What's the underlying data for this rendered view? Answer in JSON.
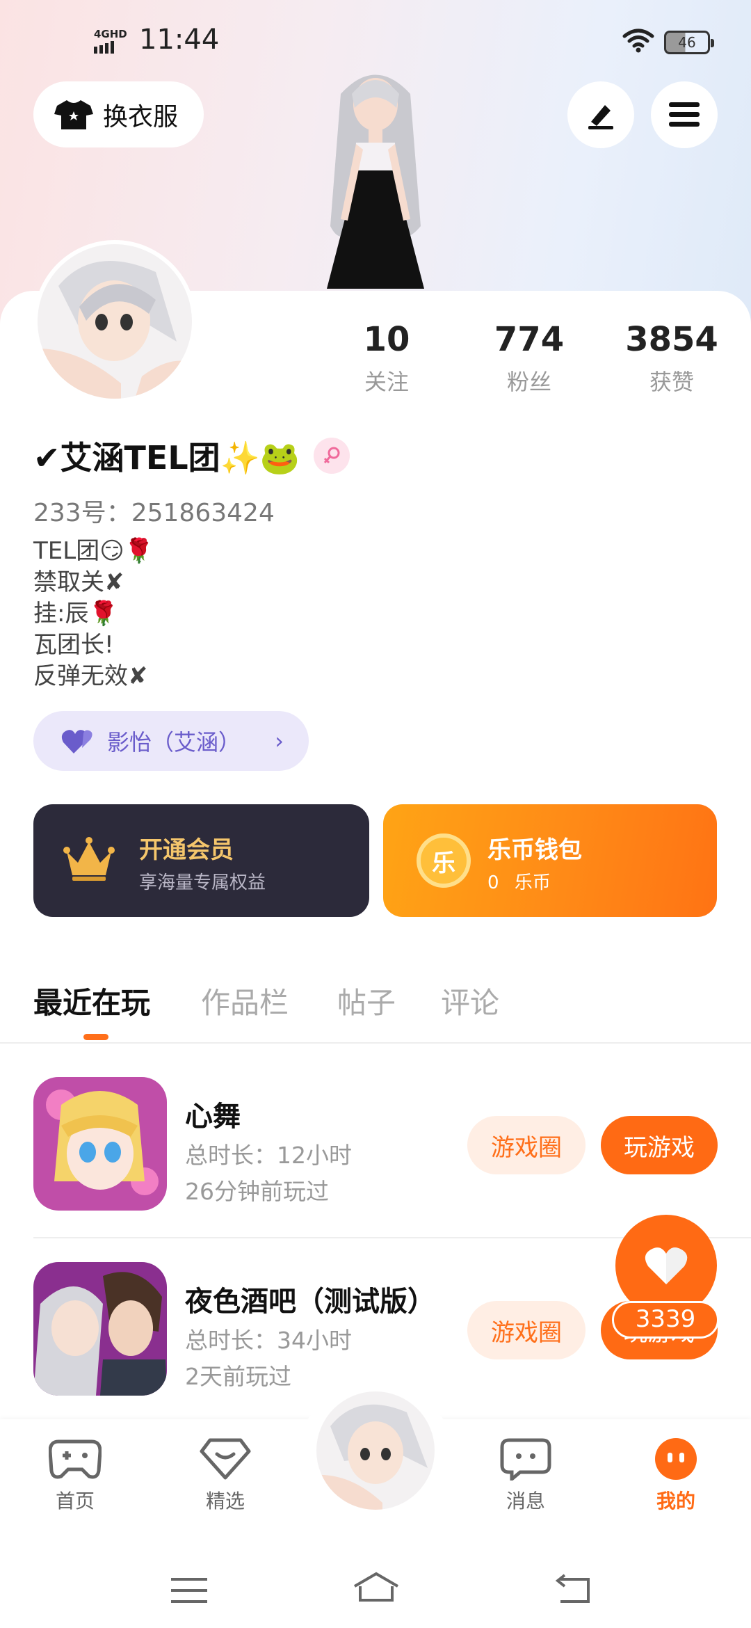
{
  "status_bar": {
    "network": "4GHD",
    "time": "11:44",
    "battery": "46"
  },
  "header": {
    "outfit_label": "换衣服"
  },
  "stats": [
    {
      "value": "10",
      "label": "关注"
    },
    {
      "value": "774",
      "label": "粉丝"
    },
    {
      "value": "3854",
      "label": "获赞"
    }
  ],
  "profile": {
    "name": "✔艾涵TEL团✨🐸",
    "uid": "233号：251863424",
    "bio": [
      "TEL团😏🌹",
      "禁取关✘",
      "挂:辰🌹",
      "瓦团长!",
      "反弹无效✘"
    ],
    "partner_label": "影怡（艾涵）"
  },
  "vip": {
    "title": "开通会员",
    "subtitle": "享海量专属权益"
  },
  "wallet": {
    "title": "乐币钱包",
    "amount": "0",
    "unit": "乐币",
    "coin_char": "乐"
  },
  "tabs": [
    "最近在玩",
    "作品栏",
    "帖子",
    "评论"
  ],
  "games": [
    {
      "name": "心舞",
      "duration": "总时长：12小时",
      "last_played": "26分钟前玩过",
      "circle_label": "游戏圈",
      "play_label": "玩游戏"
    },
    {
      "name": "夜色酒吧（测试版）",
      "duration": "总时长：34小时",
      "last_played": "2天前玩过",
      "circle_label": "游戏圈",
      "play_label": "玩游戏"
    }
  ],
  "like_count": "3339",
  "bottom_nav": [
    {
      "label": "首页",
      "icon": "gamepad-icon"
    },
    {
      "label": "精选",
      "icon": "heart-diamond-icon"
    },
    {
      "label": "消息",
      "icon": "chat-icon"
    },
    {
      "label": "我的",
      "icon": "profile-face-icon"
    }
  ],
  "colors": {
    "accent": "#ff6a14",
    "vip_bg": "#2c2a3a",
    "vip_title": "#f5c66c",
    "partner_purple": "#6a5ccb"
  }
}
